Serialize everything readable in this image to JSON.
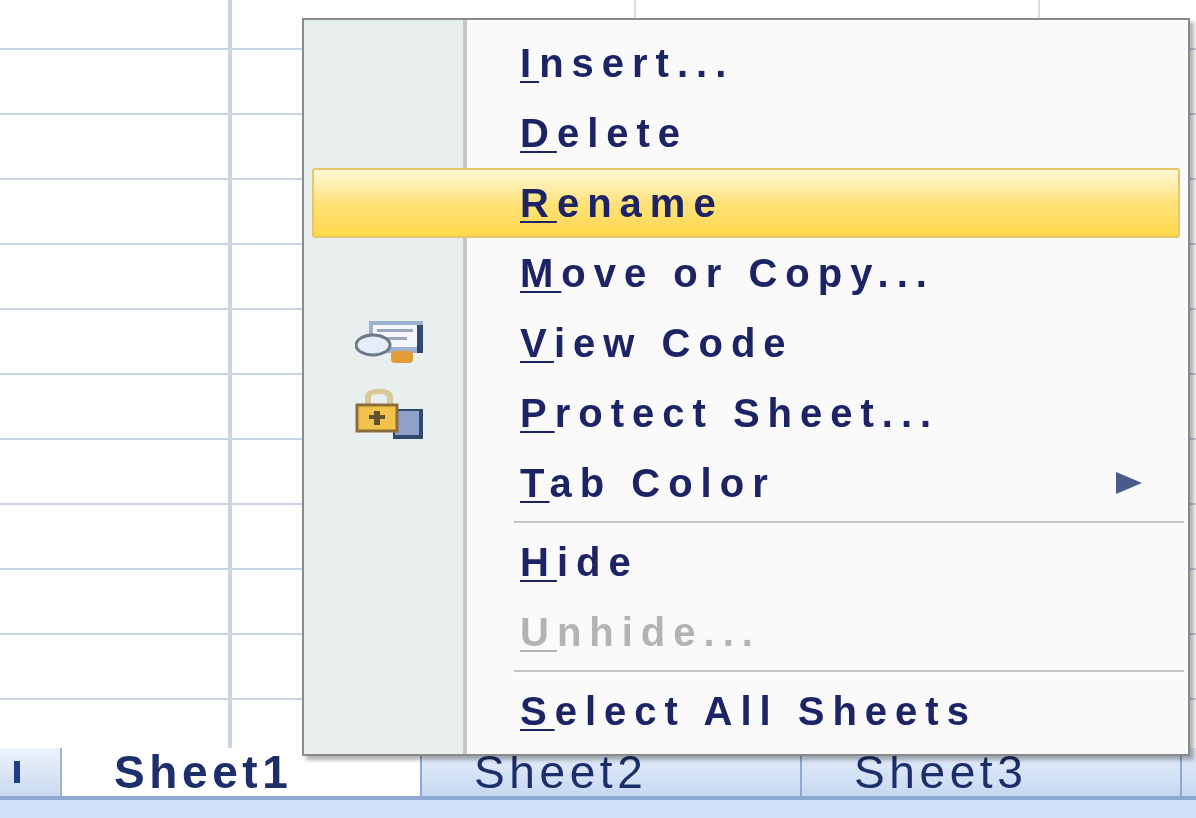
{
  "context_menu": {
    "items": [
      {
        "kind": "item",
        "label": "Insert...",
        "selected": false,
        "disabled": false
      },
      {
        "kind": "item",
        "label": "Delete",
        "selected": false,
        "disabled": false
      },
      {
        "kind": "item",
        "label": "Rename",
        "selected": true,
        "disabled": false
      },
      {
        "kind": "item",
        "label": "Move or Copy...",
        "selected": false,
        "disabled": false
      },
      {
        "kind": "code",
        "label": "View Code",
        "selected": false,
        "disabled": false
      },
      {
        "kind": "lock",
        "label": "Protect Sheet...",
        "selected": false,
        "disabled": false
      },
      {
        "kind": "submenu",
        "label": "Tab Color",
        "selected": false,
        "disabled": false
      },
      {
        "kind": "separator"
      },
      {
        "kind": "item",
        "label": "Hide",
        "selected": false,
        "disabled": false
      },
      {
        "kind": "item",
        "label": "Unhide...",
        "selected": false,
        "disabled": true
      },
      {
        "kind": "separator"
      },
      {
        "kind": "item",
        "label": "Select All Sheets",
        "selected": false,
        "disabled": false
      }
    ]
  },
  "sheet_tabs": [
    {
      "label": "Sheet1",
      "selected": true
    },
    {
      "label": "Sheet2",
      "selected": false
    },
    {
      "label": "Sheet3",
      "selected": false
    }
  ]
}
